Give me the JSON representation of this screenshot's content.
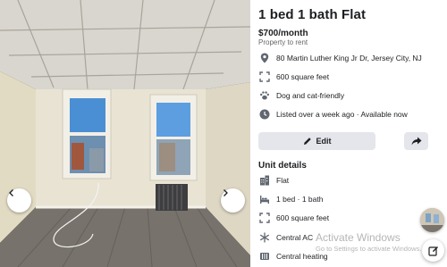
{
  "listing": {
    "title": "1 bed 1 bath Flat",
    "price": "$700/month",
    "subtitle": "Property to rent",
    "address": "80 Martin Luther King Jr Dr, Jersey City, NJ",
    "area": "600 square feet",
    "pets": "Dog and cat-friendly",
    "listed": "Listed over a week ago · Available now"
  },
  "actions": {
    "edit_label": "Edit"
  },
  "unit_details": {
    "heading": "Unit details",
    "items": [
      {
        "icon": "building-icon",
        "label": "Flat"
      },
      {
        "icon": "bed-icon",
        "label": "1 bed · 1 bath"
      },
      {
        "icon": "area-icon",
        "label": "600 square feet"
      },
      {
        "icon": "snowflake-icon",
        "label": "Central AC"
      },
      {
        "icon": "heating-icon",
        "label": "Central heating"
      }
    ]
  },
  "watermark": {
    "title": "Activate Windows",
    "subtitle": "Go to Settings to activate Windows."
  },
  "colors": {
    "button_bg": "#e4e6eb",
    "text_primary": "#1c1e21",
    "text_secondary": "#65676b",
    "icon": "#606770"
  }
}
